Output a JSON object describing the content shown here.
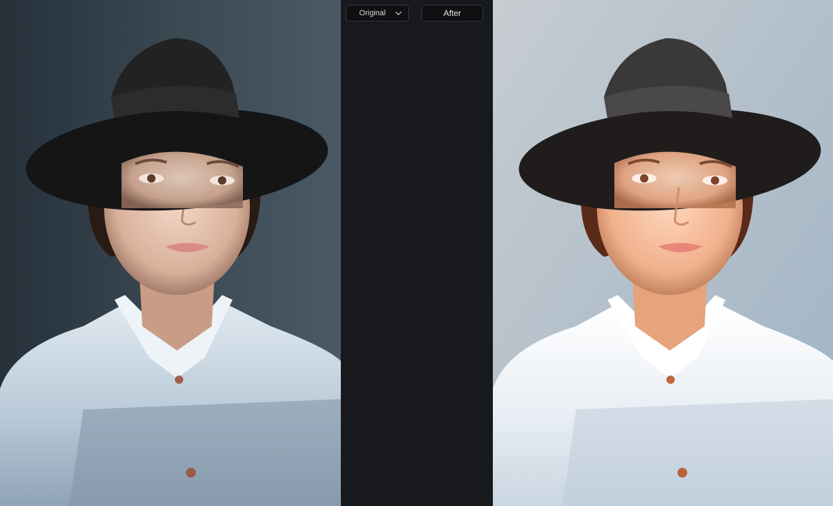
{
  "toolbar": {
    "view_select": {
      "selected": "Original",
      "icon": "chevron-down-icon"
    },
    "after_label": "After"
  },
  "panes": {
    "left": {
      "description_icon": "portrait-image"
    },
    "right": {
      "description_icon": "portrait-image"
    }
  },
  "colors": {
    "panel_bg": "#17191c",
    "control_bg": "#0f1012",
    "control_border": "#34373c",
    "control_text": "#d8dadd"
  }
}
